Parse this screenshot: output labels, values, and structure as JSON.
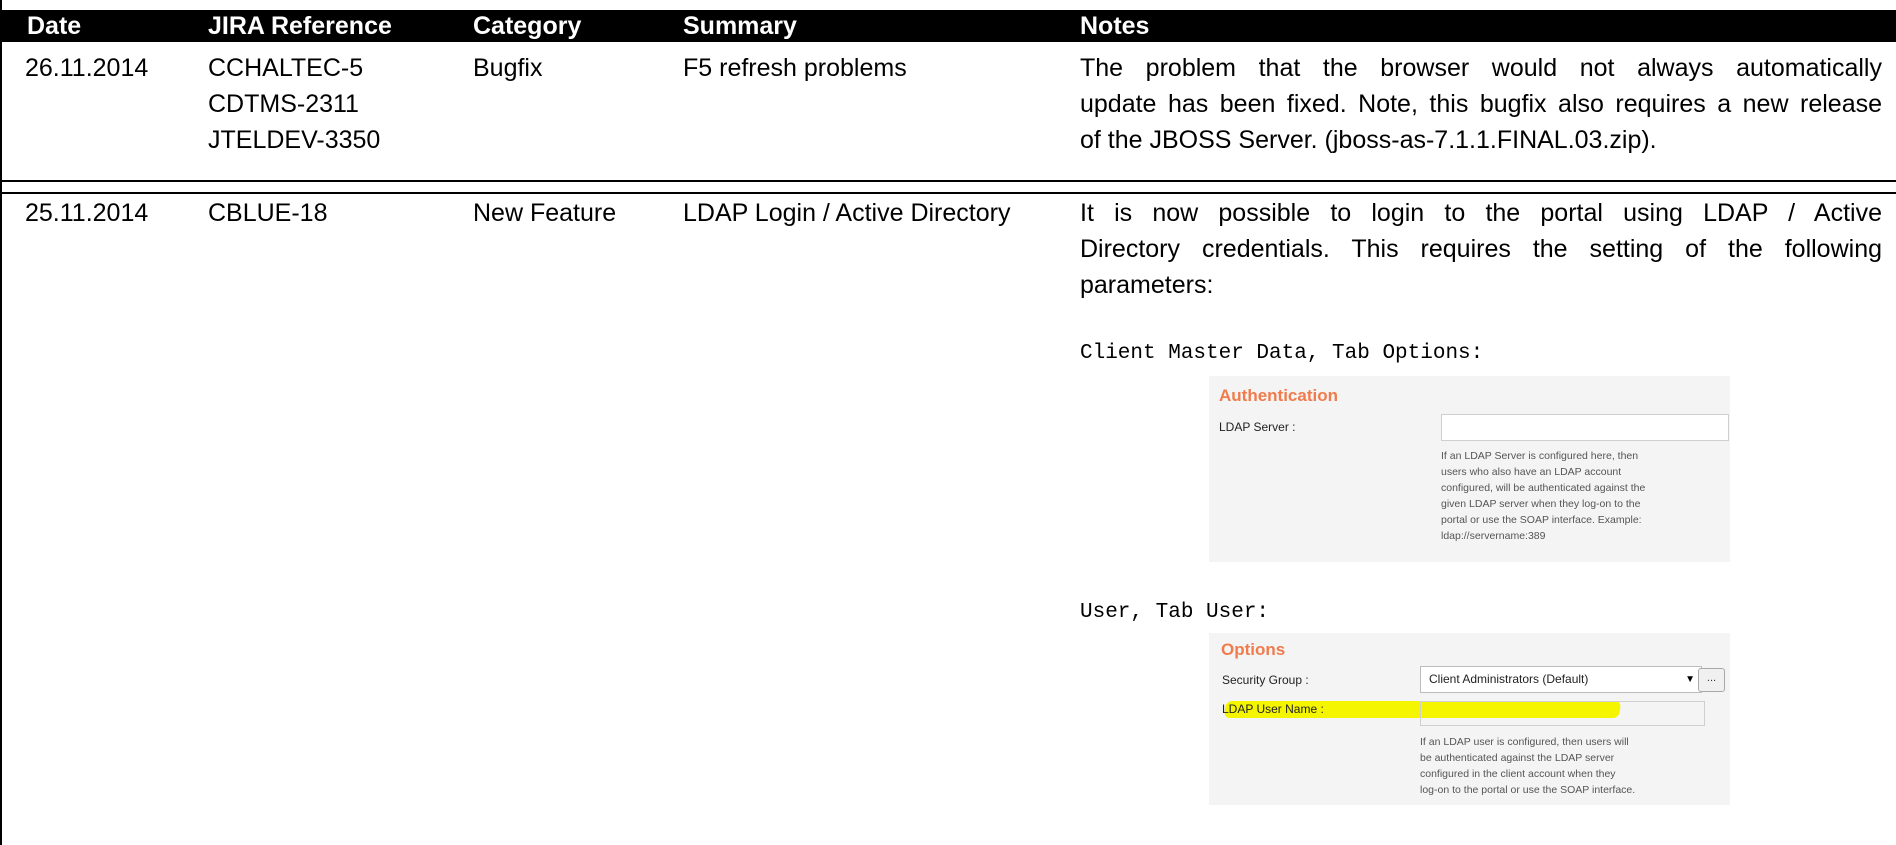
{
  "table": {
    "headers": [
      "Date",
      "JIRA Reference",
      "Category",
      "Summary",
      "Notes"
    ],
    "rows": [
      {
        "date": "26.11.2014",
        "jira": [
          "CCHALTEC-5",
          "CDTMS-2311",
          "JTELDEV-3350"
        ],
        "category": "Bugfix",
        "summary": "F5 refresh problems",
        "notes": [
          "The problem that the browser would not always automatically",
          "update has been fixed. Note, this bugfix also requires a new release",
          "of the JBOSS Server. (jboss-as-7.1.1.FINAL.03.zip)."
        ]
      },
      {
        "date": "25.11.2014",
        "jira": [
          "CBLUE-18"
        ],
        "category": "New Feature",
        "summary": "LDAP Login / Active Directory",
        "notes": [
          "It is now possible to login to the portal using LDAP / Active",
          "Directory credentials. This requires the setting of the following",
          "parameters:"
        ],
        "client_caption": "Client Master Data, Tab Options:",
        "user_caption": "User, Tab User:"
      }
    ]
  },
  "auth_panel": {
    "title": "Authentication",
    "ldap_server_label": "LDAP Server :",
    "ldap_server_value": "",
    "help": [
      "If an LDAP Server is configured here, then",
      "users who also have an LDAP account",
      "configured, will be authenticated against the",
      "given LDAP server when they log-on to the",
      "portal or use the SOAP interface. Example:",
      "ldap://servername:389"
    ]
  },
  "options_panel": {
    "title": "Options",
    "security_group_label": "Security Group :",
    "security_group_value": "Client Administrators (Default)",
    "caret_glyph": "▼",
    "more_button": "...",
    "ldap_user_label": "LDAP User Name :",
    "ldap_user_value": "",
    "highlight_color": "#f5f500",
    "help": [
      "If an LDAP user is configured, then users will",
      "be authenticated against the LDAP server",
      "configured in the client account when they",
      "log-on to the portal or use the SOAP interface."
    ]
  },
  "colors": {
    "header_bg": "#000000",
    "header_text": "#ffffff",
    "panel_title": "#f07c4e",
    "panel_bg": "#f4f4f4"
  }
}
